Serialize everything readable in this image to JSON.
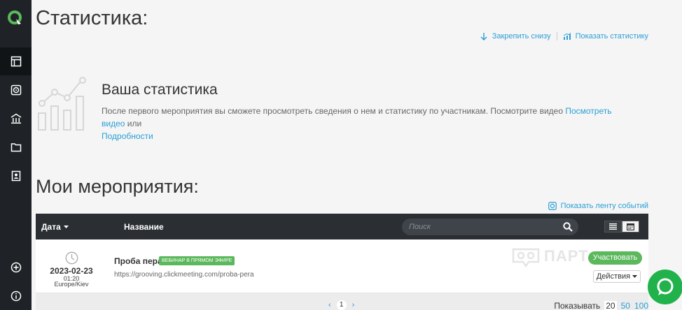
{
  "page": {
    "title": "Статистика:"
  },
  "top_links": {
    "pin_bottom": "Закрепить снизу",
    "show_stats": "Показать статистику"
  },
  "stats": {
    "heading": "Ваша статистика",
    "text": "После первого мероприятия вы сможете просмотреть сведения о нем и статистику по участникам. Посмотрите видео ",
    "video_link": "Посмотреть видео",
    "or": " или ",
    "details_link": "Подробности"
  },
  "events": {
    "title": "Мои мероприятия:",
    "feed_link": "Показать ленту событий",
    "columns": {
      "date": "Дата",
      "name": "Название"
    },
    "search_placeholder": "Поиск",
    "rows": [
      {
        "date": "2023-02-23",
        "time": "01:20",
        "timezone": "Europe/Kiev",
        "name": "Проба пера",
        "badge": "ВЕБИНАР В ПРЯМОМ ЭФИРЕ",
        "url": "https://grooving.clickmeeting.com/proba-pera",
        "join_label": "Участвовать",
        "actions_label": "Действия",
        "watermark": "ПАРТ"
      }
    ],
    "pager": {
      "current_page": "1",
      "prev": "‹",
      "next": "›"
    },
    "per_page": {
      "label": "Показывать",
      "options": [
        "20",
        "50",
        "100"
      ]
    }
  },
  "colors": {
    "sidebar": "#1f2327",
    "link": "#2a9fd6",
    "green": "#5cb85c",
    "table_header": "#2b2f33",
    "chat": "#22b24c"
  }
}
